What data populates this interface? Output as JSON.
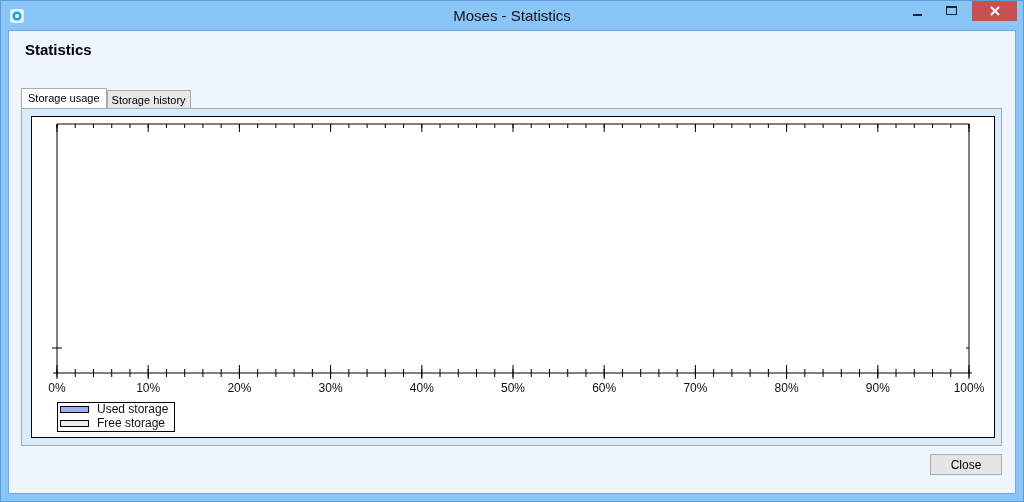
{
  "window": {
    "title": "Moses - Statistics"
  },
  "heading": "Statistics",
  "tabs": [
    {
      "label": "Storage usage",
      "selected": true
    },
    {
      "label": "Storage history",
      "selected": false
    }
  ],
  "storage_chart": {
    "axis_labels": [
      "0%",
      "10%",
      "20%",
      "30%",
      "40%",
      "50%",
      "60%",
      "70%",
      "80%",
      "90%",
      "100%"
    ],
    "legend": [
      {
        "label": "Used storage",
        "color": "#9db0f0"
      },
      {
        "label": "Free storage",
        "color": "#ececec"
      }
    ]
  },
  "buttons": [
    {
      "label": "Close"
    }
  ]
}
